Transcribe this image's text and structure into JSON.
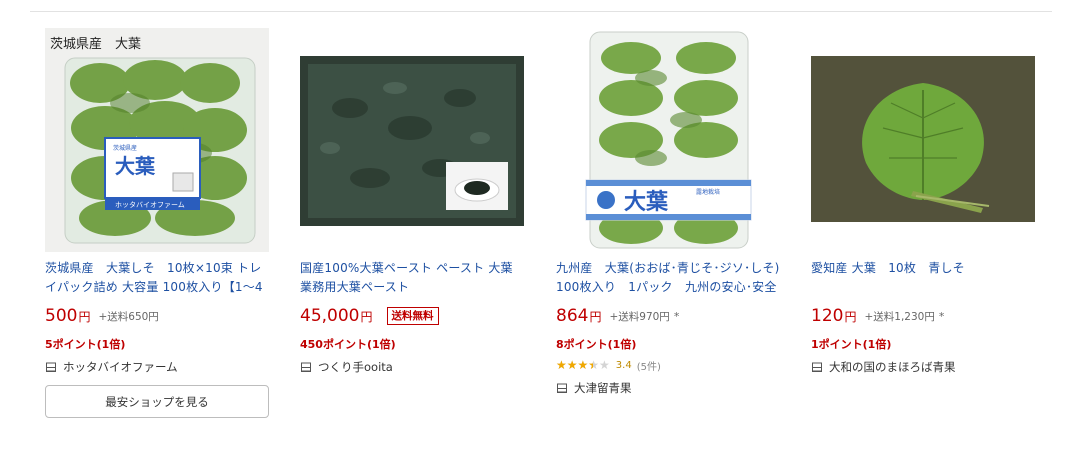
{
  "products": [
    {
      "title": "茨城県産　大葉しそ　10枚×10束 トレイパック詰め 大容量 100枚入り【1〜4個…",
      "price": "500",
      "yen": "円",
      "shipping": "+送料650円",
      "points": "5ポイント(1倍)",
      "shop": "ホッタバイオファーム",
      "button_label": "最安ショップを見る",
      "image_caption": "茨城県産　大葉",
      "package_label": "大葉",
      "package_sub": "茨城県産",
      "package_maker": "ホッタバイオファーム"
    },
    {
      "title": "国産100%大葉ペースト ペースト 大葉 業務用大葉ペースト",
      "price": "45,000",
      "yen": "円",
      "badge": "送料無料",
      "points": "450ポイント(1倍)",
      "shop": "つくり手ooita"
    },
    {
      "title": "九州産　大葉(おおば･青じそ･ジソ･しそ) 100枚入り　1パック　九州の安心･安全な…",
      "price": "864",
      "yen": "円",
      "shipping": "+送料970円",
      "asterisk": "*",
      "points": "8ポイント(1倍)",
      "rating": 3.4,
      "rating_text": "3.4",
      "review_count": "(5件)",
      "shop": "大津留青果",
      "package_label": "大葉",
      "package_sub": "露地栽培"
    },
    {
      "title": "愛知産 大葉　10枚　青しそ",
      "price": "120",
      "yen": "円",
      "shipping": "+送料1,230円",
      "asterisk": "*",
      "points": "1ポイント(1倍)",
      "shop": "大和の国のまほろば青果"
    }
  ],
  "colors": {
    "link": "#1e50a2",
    "price": "#bf0000",
    "star": "#f0a800"
  },
  "icons": {
    "shop": "shop-icon",
    "star": "star-icon"
  }
}
